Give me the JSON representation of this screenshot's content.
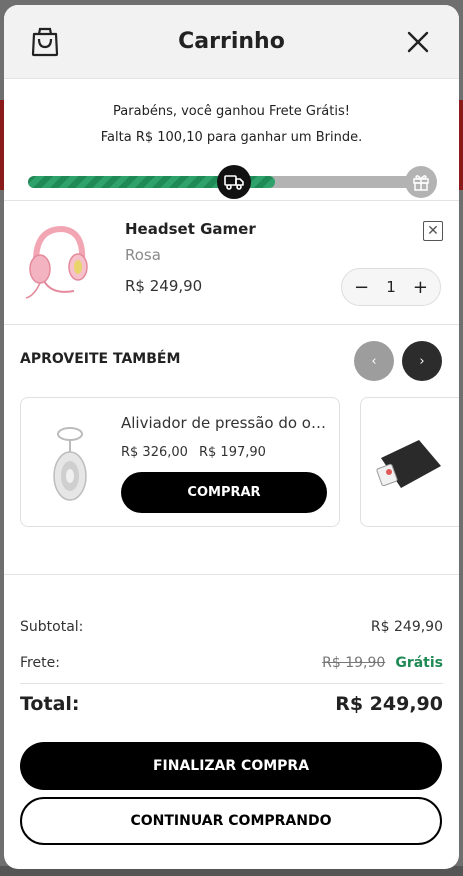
{
  "header": {
    "title": "Carrinho",
    "bag_icon": "shopping-bag-icon",
    "close_icon": "close-icon"
  },
  "shipping": {
    "line1": "Parabéns, você ganhou Frete Grátis!",
    "line2": "Falta R$ 100,10 para ganhar um Brinde.",
    "progress_fraction": 0.62,
    "accent": "#1f8a55"
  },
  "cart_item": {
    "name": "Headset Gamer",
    "variant": "Rosa",
    "price": "R$ 249,90",
    "quantity": "1",
    "minus": "−",
    "plus": "+"
  },
  "upsell": {
    "title": "APROVEITE TAMBÉM",
    "products": [
      {
        "name": "Aliviador de pressão do ouvido",
        "old_price": "R$ 326,00",
        "new_price": "R$ 197,90",
        "button": "COMPRAR"
      }
    ]
  },
  "totals": {
    "subtotal_label": "Subtotal:",
    "subtotal_value": "R$ 249,90",
    "shipping_label": "Frete:",
    "shipping_old": "R$ 19,90",
    "shipping_value": "Grátis",
    "total_label": "Total:",
    "total_value": "R$ 249,90"
  },
  "actions": {
    "checkout": "FINALIZAR COMPRA",
    "continue": "CONTINUAR COMPRANDO"
  }
}
